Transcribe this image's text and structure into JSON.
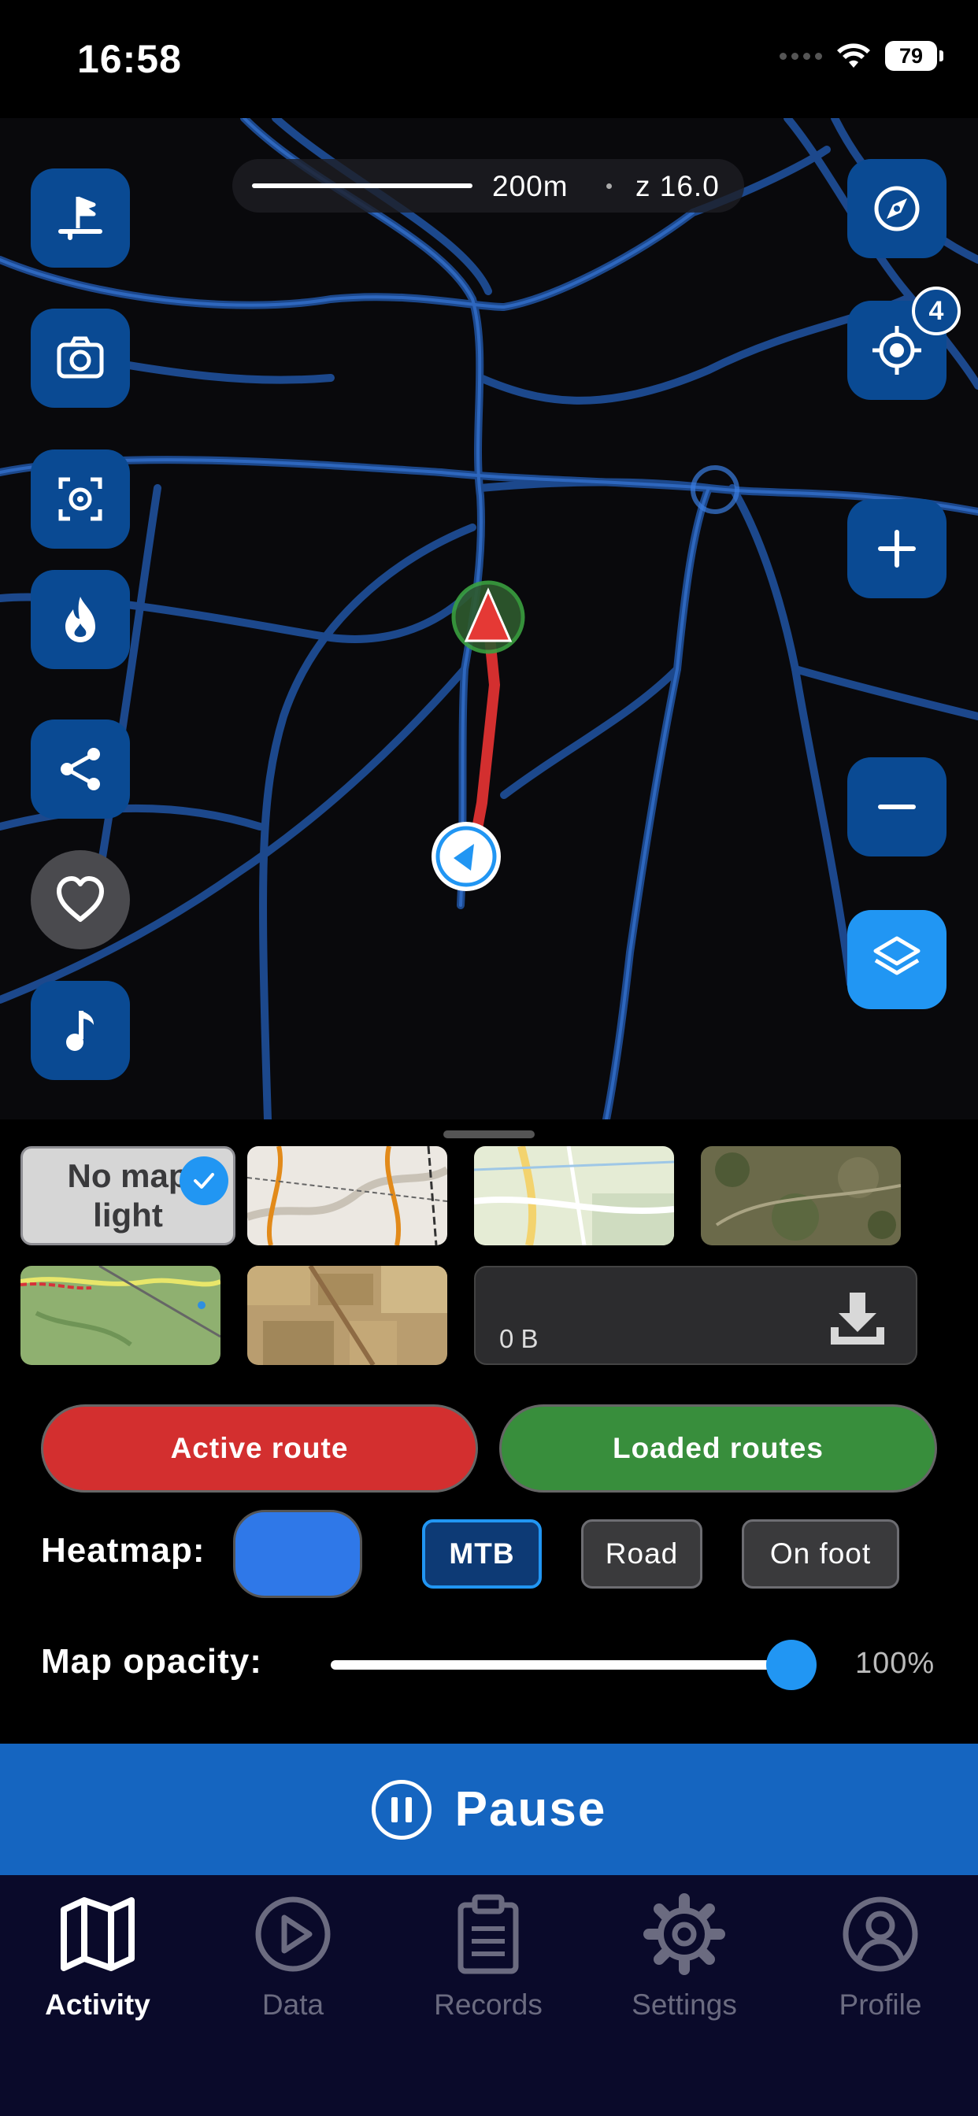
{
  "status_bar": {
    "time": "16:58",
    "battery": "79"
  },
  "map": {
    "scale_label": "200m",
    "zoom_label": "z 16.0",
    "gps_badge": "4",
    "icons": [
      "flag-icon",
      "camera-icon",
      "scan-icon",
      "fire-icon",
      "share-icon",
      "heart-icon",
      "music-icon",
      "compass-icon",
      "locate-icon",
      "plus-icon",
      "minus-icon",
      "layers-icon"
    ]
  },
  "layers": {
    "no_map_label": "No map light",
    "download_size": "0 B",
    "active_route_label": "Active route",
    "loaded_routes_label": "Loaded routes",
    "heatmap_label": "Heatmap:",
    "heatmap_color": "#2f78e8",
    "heatmap_options": [
      "MTB",
      "Road",
      "On foot"
    ],
    "heatmap_selected": "MTB",
    "opacity_label": "Map opacity:",
    "opacity_value": "100%",
    "opacity_fraction": 1.0
  },
  "pause_label": "Pause",
  "tabs": [
    {
      "label": "Activity",
      "icon": "map-icon",
      "active": true
    },
    {
      "label": "Data",
      "icon": "play-icon",
      "active": false
    },
    {
      "label": "Records",
      "icon": "clipboard-icon",
      "active": false
    },
    {
      "label": "Settings",
      "icon": "gear-icon",
      "active": false
    },
    {
      "label": "Profile",
      "icon": "user-icon",
      "active": false
    }
  ],
  "colors": {
    "accent": "#2196f3",
    "button_blue": "#0a4a93",
    "route_red": "#d32f2f",
    "routes_green": "#388e3c",
    "pause_blue": "#1565c0"
  }
}
